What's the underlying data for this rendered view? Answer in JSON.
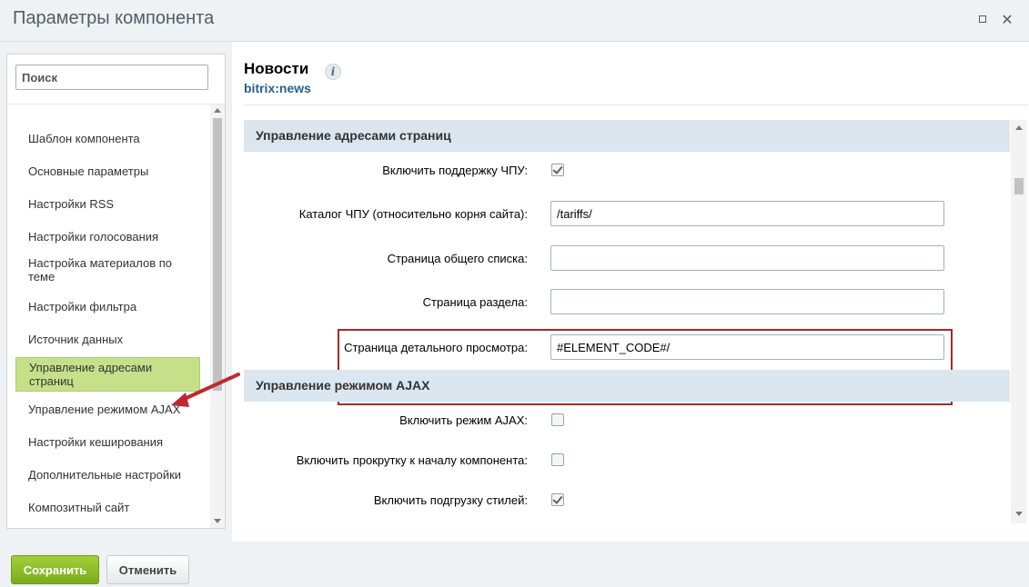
{
  "window": {
    "title": "Параметры компонента",
    "maximize_icon": "maximize-icon",
    "close_icon": "close-icon",
    "close_glyph": "✕"
  },
  "sidebar": {
    "search_placeholder": "Поиск",
    "items": [
      {
        "label": "Шаблон компонента"
      },
      {
        "label": "Основные параметры"
      },
      {
        "label": "Настройки RSS"
      },
      {
        "label": "Настройки голосования"
      },
      {
        "label": "Настройка материалов по теме"
      },
      {
        "label": "Настройки фильтра"
      },
      {
        "label": "Источник данных"
      },
      {
        "label": "Управление адресами страниц",
        "active": true
      },
      {
        "label": "Управление режимом AJAX"
      },
      {
        "label": "Настройки кеширования"
      },
      {
        "label": "Дополнительные настройки"
      },
      {
        "label": "Композитный сайт"
      }
    ]
  },
  "component": {
    "name": "Новости",
    "code": "bitrix:news",
    "info_glyph": "i"
  },
  "sections": [
    {
      "title": "Управление адресами страниц",
      "params": [
        {
          "label": "Включить поддержку ЧПУ:",
          "type": "checkbox",
          "checked": true
        },
        {
          "label": "Каталог ЧПУ (относительно корня сайта):",
          "type": "text",
          "value": "/tariffs/"
        },
        {
          "label": "Страница общего списка:",
          "type": "text",
          "value": ""
        },
        {
          "label": "Страница раздела:",
          "type": "text",
          "value": ""
        },
        {
          "label": "Страница детального просмотра:",
          "type": "text",
          "value": "#ELEMENT_CODE#/"
        }
      ]
    },
    {
      "title": "Управление режимом AJAX",
      "params": [
        {
          "label": "Включить режим AJAX:",
          "type": "checkbox",
          "checked": false
        },
        {
          "label": "Включить прокрутку к началу компонента:",
          "type": "checkbox",
          "checked": false
        },
        {
          "label": "Включить подгрузку стилей:",
          "type": "checkbox",
          "checked": true
        }
      ]
    }
  ],
  "footer": {
    "save_label": "Сохранить",
    "cancel_label": "Отменить"
  },
  "colors": {
    "accent_green": "#8ebb2a",
    "active_item": "#c6e08a",
    "section_header": "#dbe6ef",
    "highlight_border": "#a32a2a",
    "annotation_arrow": "#c0282d"
  }
}
